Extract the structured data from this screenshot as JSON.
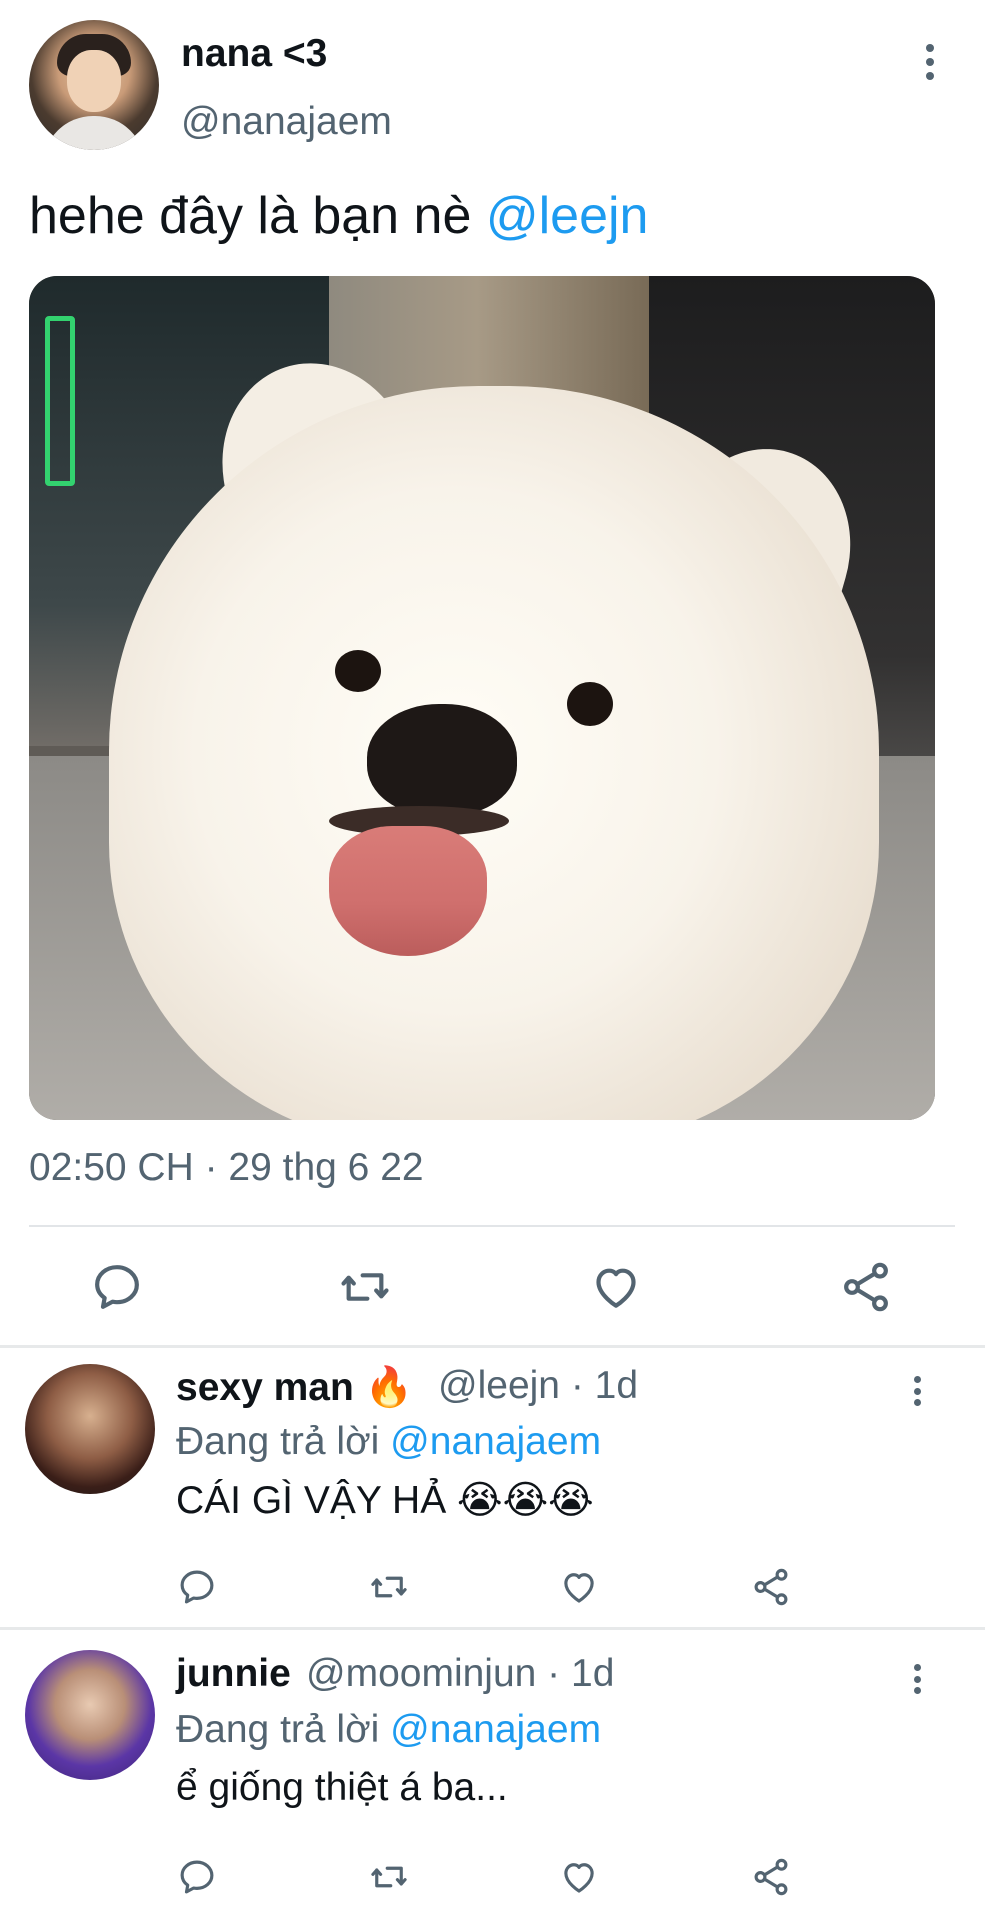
{
  "tweet": {
    "author": {
      "display_name": "nana <3",
      "handle": "@nanajaem"
    },
    "text": "hehe đây là bạn nè ",
    "mention": "@leejn",
    "image_alt": "fluffy white dog sticking its tongue out",
    "timestamp": "02:50 CH · 29 thg 6 22",
    "actions": [
      "reply-icon",
      "retweet-icon",
      "like-icon",
      "share-icon"
    ]
  },
  "replies": [
    {
      "display_name": "sexy man",
      "emoji": "🔥",
      "handle": "@leejn",
      "time_sep": " · ",
      "time": "1d",
      "replying_prefix": "Đang trả lời ",
      "replying_to": "@nanajaem",
      "text": "CÁI GÌ VẬY HẢ ",
      "emojis": "😭😭😭"
    },
    {
      "display_name": "junnie",
      "emoji": "",
      "handle": "@moominjun",
      "time_sep": " · ",
      "time": "1d",
      "replying_prefix": "Đang trả lời ",
      "replying_to": "@nanajaem",
      "text": "ể giống thiệt á ba...",
      "emojis": ""
    }
  ],
  "colors": {
    "text": "#0f1419",
    "secondary": "#536471",
    "link": "#1d9bf0",
    "divider": "#e7e9ea"
  }
}
